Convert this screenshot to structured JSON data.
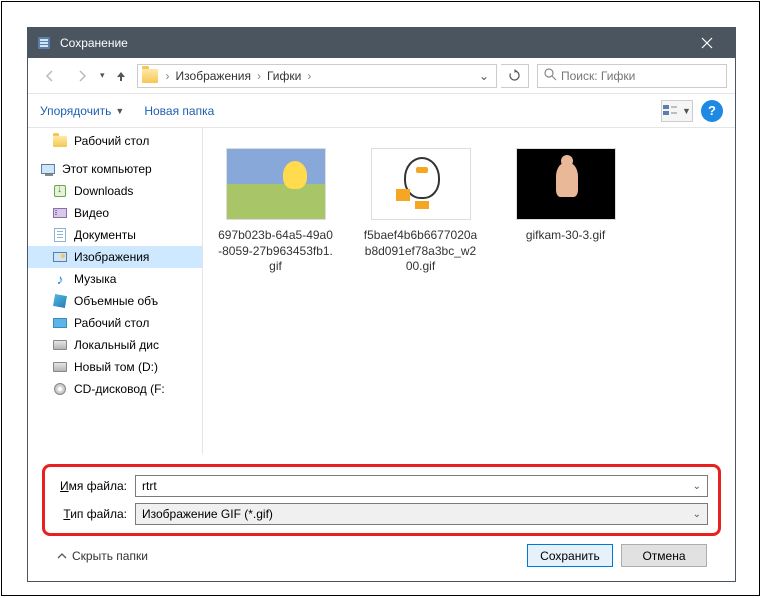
{
  "title": "Сохранение",
  "breadcrumb": {
    "part1": "Изображения",
    "part2": "Гифки"
  },
  "search": {
    "placeholder": "Поиск: Гифки"
  },
  "toolbar": {
    "organize": "Упорядочить",
    "newFolder": "Новая папка"
  },
  "tree": {
    "desktop": "Рабочий стол",
    "thisPc": "Этот компьютер",
    "downloads": "Downloads",
    "video": "Видео",
    "documents": "Документы",
    "images": "Изображения",
    "music": "Музыка",
    "objects3d": "Объемные объ",
    "desktop2": "Рабочий стол",
    "localDisk": "Локальный дис",
    "newVolume": "Новый том (D:)",
    "cdDrive": "CD-дисковод (F:"
  },
  "files": {
    "f1": "697b023b-64a5-49a0-8059-27b963453fb1.gif",
    "f2": "f5baef4b6b6677020ab8d091ef78a3bc_w200.gif",
    "f3": "gifkam-30-3.gif"
  },
  "labels": {
    "filename": "Имя файла:",
    "filetype": "Тип файла:",
    "filenameU": "И",
    "filetypeU": "Т"
  },
  "values": {
    "filename": "rtrt",
    "filetype": "Изображение GIF (*.gif)"
  },
  "footer": {
    "hide": "Скрыть папки",
    "save": "Сохранить",
    "cancel": "Отмена"
  }
}
